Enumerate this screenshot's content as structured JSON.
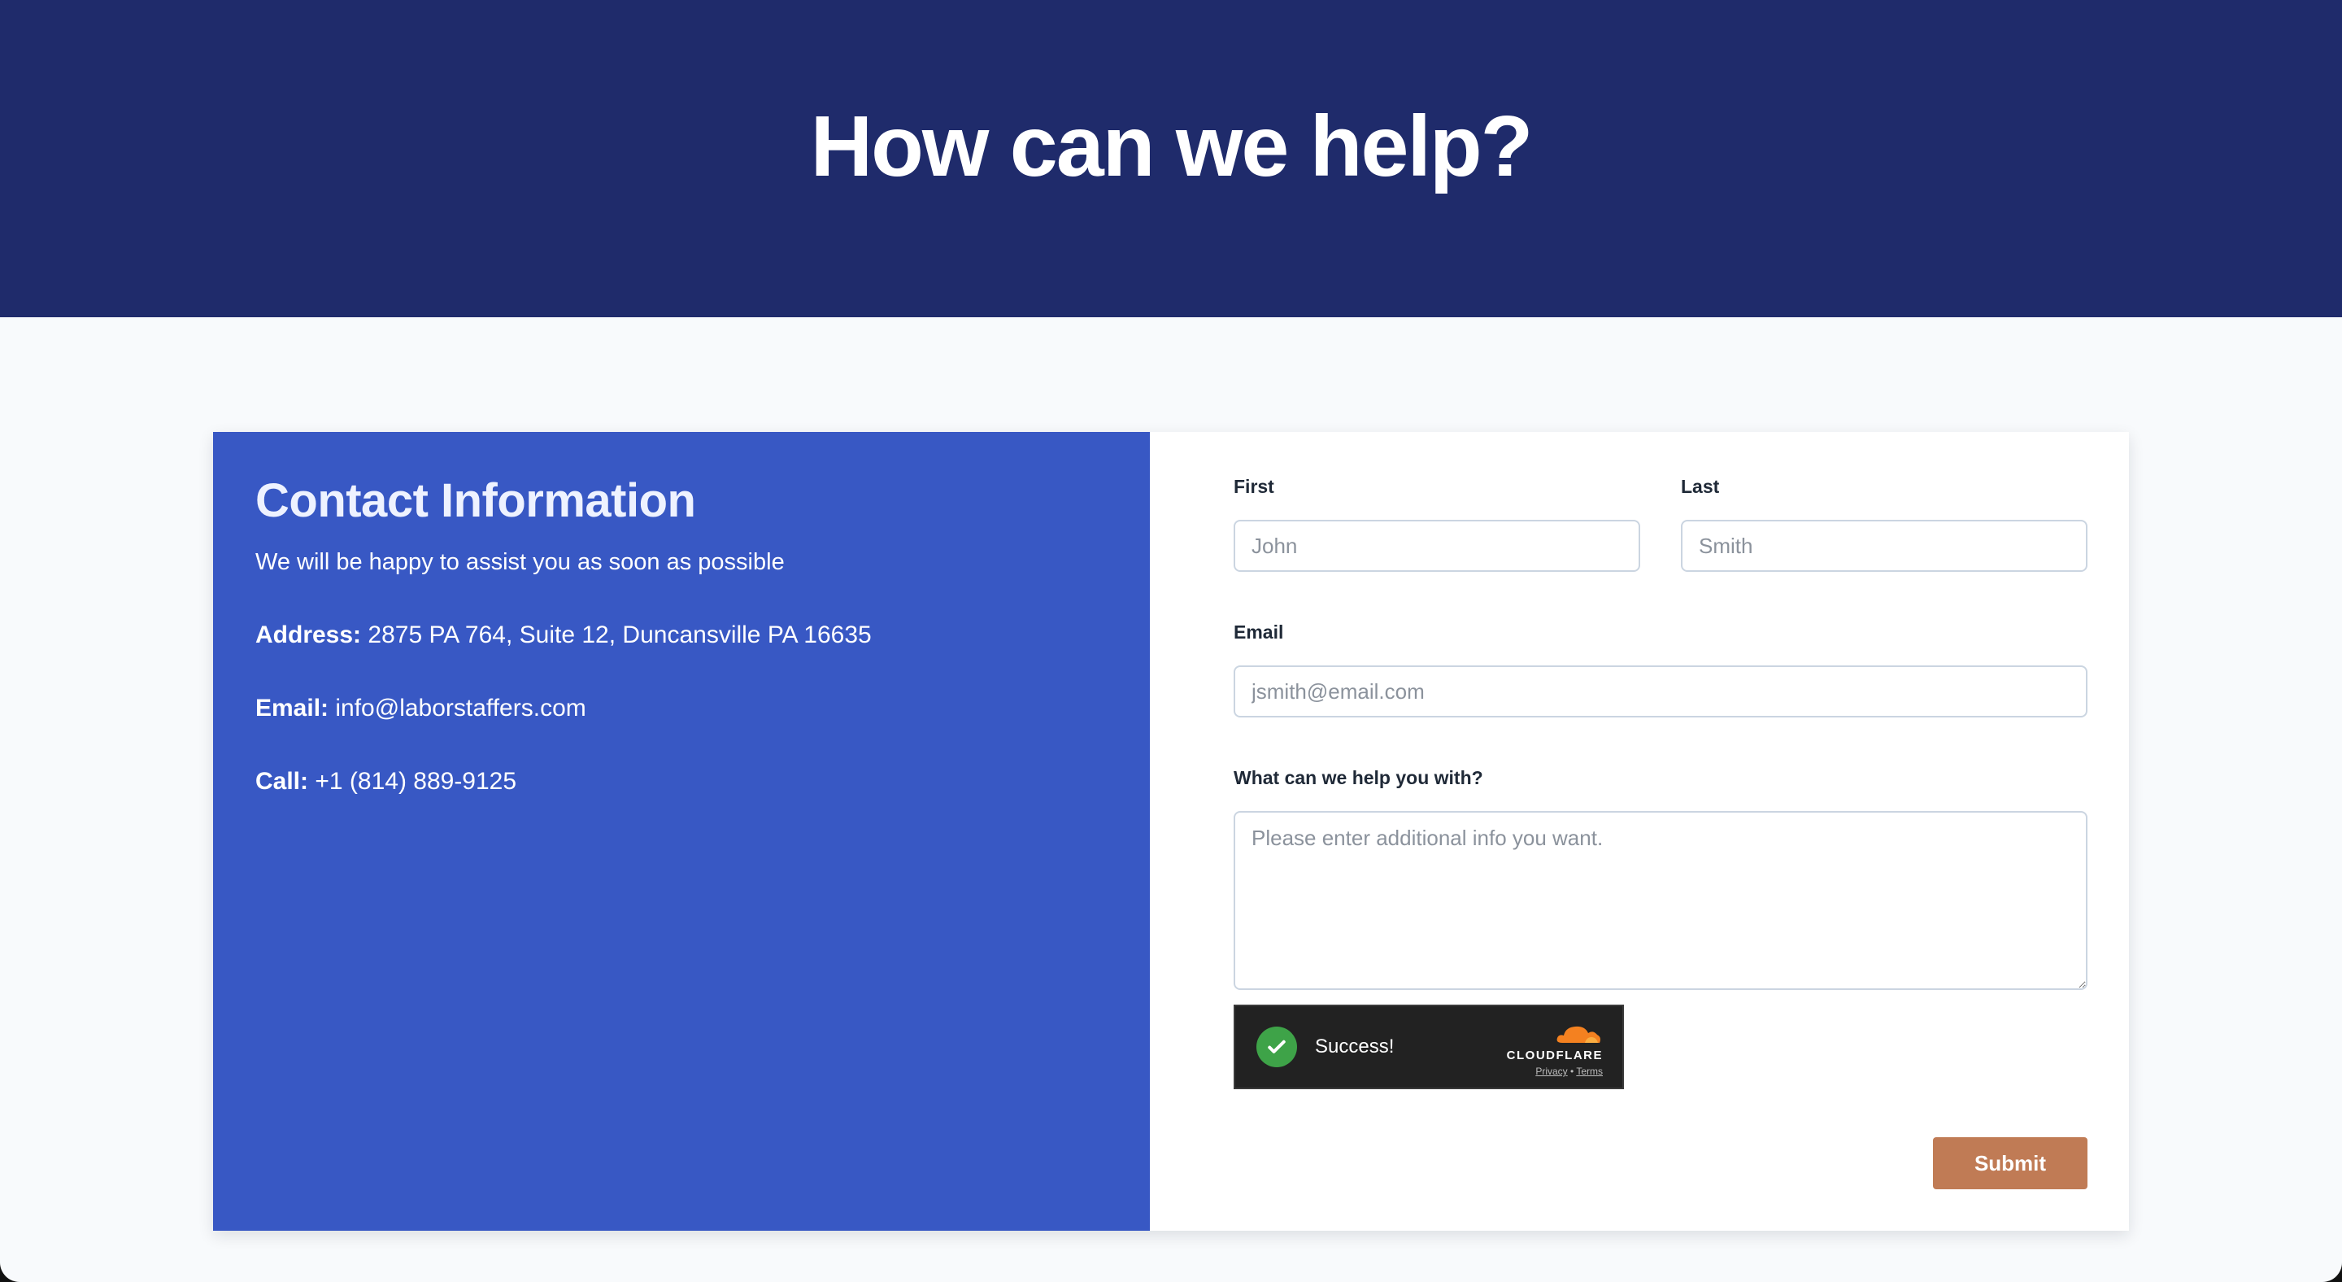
{
  "hero": {
    "title": "How can we help?"
  },
  "contact": {
    "title": "Contact Information",
    "lead": "We will be happy to assist you as soon as possible",
    "address_label": "Address:",
    "address_value": "2875 PA 764, Suite 12, Duncansville PA 16635",
    "email_label": "Email:",
    "email_value": "info@laborstaffers.com",
    "call_label": "Call:",
    "call_value": "+1 (814) 889-9125"
  },
  "form": {
    "first_label": "First",
    "first_placeholder": "John",
    "last_label": "Last",
    "last_placeholder": "Smith",
    "email_label": "Email",
    "email_placeholder": "jsmith@email.com",
    "message_label": "What can we help you with?",
    "message_placeholder": "Please enter additional info you want.",
    "submit_label": "Submit"
  },
  "captcha": {
    "status": "Success!",
    "brand": "CLOUDFLARE",
    "privacy": "Privacy",
    "separator": "•",
    "terms": "Terms",
    "check_color": "#3ea348",
    "cloud_color": "#f48120"
  },
  "colors": {
    "hero_bg": "#1f2b6b",
    "info_bg": "#3858c4",
    "submit_bg": "#c07b55"
  }
}
